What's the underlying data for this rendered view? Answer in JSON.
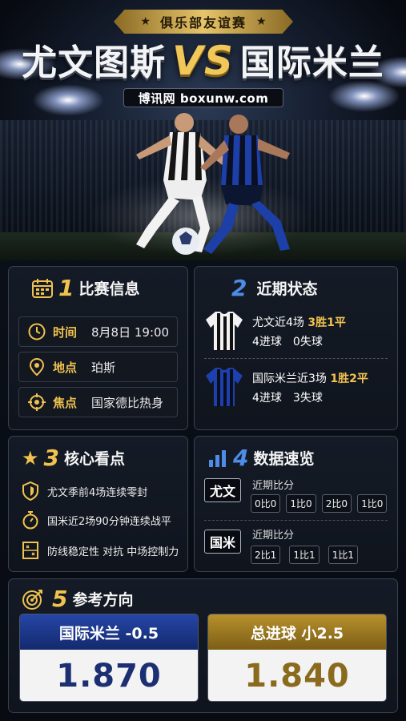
{
  "header": {
    "banner": "俱乐部友谊赛",
    "home": "尤文图斯",
    "vs": "VS",
    "away": "国际米兰",
    "site": "博讯网 boxunw.com"
  },
  "colors": {
    "gold": "#f0c24f",
    "blue": "#4d8de8",
    "inter_blue": "#1f3b8c",
    "gold_box": "#a9821f"
  },
  "match_info": {
    "number": "1",
    "title": "比赛信息",
    "rows": [
      {
        "icon": "clock-icon",
        "label": "时间",
        "value": "8月8日 19:00"
      },
      {
        "icon": "location-pin-icon",
        "label": "地点",
        "value": "珀斯"
      },
      {
        "icon": "target-icon",
        "label": "焦点",
        "value": "国家德比热身"
      }
    ]
  },
  "recent_form": {
    "number": "2",
    "title": "近期状态",
    "teams": [
      {
        "icon": "juventus-jersey-icon",
        "line1_prefix": "尤文近4场",
        "line1_highlight": "3胜1平",
        "line2": "4进球　0失球"
      },
      {
        "icon": "inter-jersey-icon",
        "line1_prefix": "国际米兰近3场",
        "line1_highlight": "1胜2平",
        "line2": "4进球　3失球"
      }
    ]
  },
  "key_points": {
    "number": "3",
    "title": "核心看点",
    "items": [
      {
        "icon": "shield-icon",
        "text": "尤文季前4场连续零封"
      },
      {
        "icon": "stopwatch-icon",
        "text": "国米近2场90分钟连续战平"
      },
      {
        "icon": "tactics-board-icon",
        "text": "防线稳定性 对抗 中场控制力"
      }
    ]
  },
  "data_overview": {
    "number": "4",
    "title": "数据速览",
    "teams": [
      {
        "tag": "尤文",
        "label": "近期比分",
        "scores": [
          "0比0",
          "1比0",
          "2比0",
          "1比0"
        ]
      },
      {
        "tag": "国米",
        "label": "近期比分",
        "scores": [
          "2比1",
          "1比1",
          "1比1"
        ]
      }
    ]
  },
  "reference": {
    "number": "5",
    "title": "参考方向",
    "picks": [
      {
        "label": "国际米兰 -0.5",
        "odds": "1.870"
      },
      {
        "label": "总进球 小2.5",
        "odds": "1.840"
      }
    ]
  }
}
